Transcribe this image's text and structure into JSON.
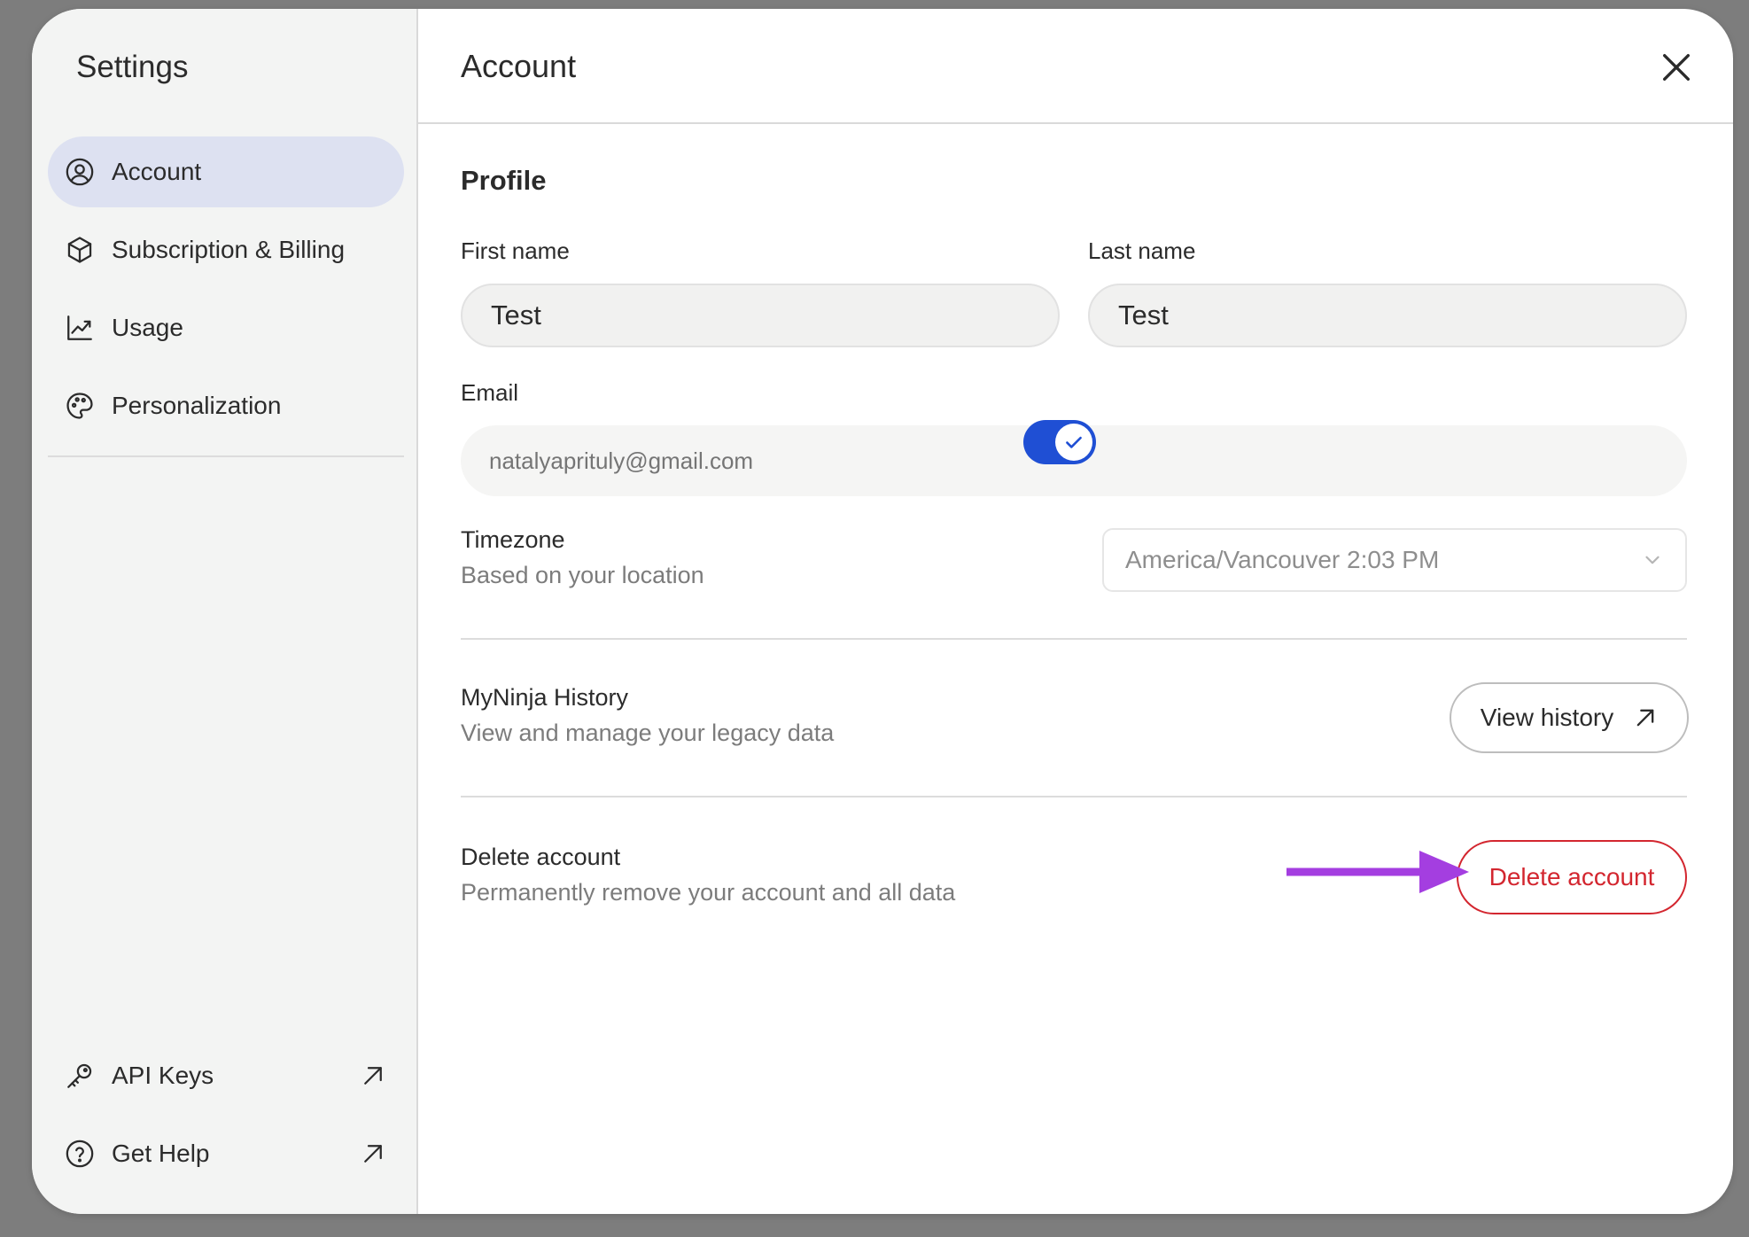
{
  "sidebar": {
    "title": "Settings",
    "items": [
      {
        "label": "Account",
        "icon": "user-circle-icon",
        "active": true
      },
      {
        "label": "Subscription & Billing",
        "icon": "cube-icon",
        "active": false
      },
      {
        "label": "Usage",
        "icon": "chart-line-icon",
        "active": false
      },
      {
        "label": "Personalization",
        "icon": "palette-icon",
        "active": false
      }
    ],
    "bottom_items": [
      {
        "label": "API Keys",
        "icon": "key-icon",
        "external": true
      },
      {
        "label": "Get Help",
        "icon": "help-circle-icon",
        "external": true
      }
    ]
  },
  "main": {
    "title": "Account",
    "profile": {
      "section_title": "Profile",
      "first_name_label": "First name",
      "first_name_value": "Test",
      "last_name_label": "Last name",
      "last_name_value": "Test",
      "email_label": "Email",
      "email_placeholder": "natalyaprituly@gmail.com"
    },
    "timezone": {
      "title": "Timezone",
      "subtitle": "Based on your location",
      "auto_enabled": true,
      "selected": "America/Vancouver 2:03 PM"
    },
    "history": {
      "title": "MyNinja History",
      "subtitle": "View and manage your legacy data",
      "button_label": "View history"
    },
    "delete": {
      "title": "Delete account",
      "subtitle": "Permanently remove your account and all data",
      "button_label": "Delete account"
    }
  },
  "colors": {
    "accent": "#1f4fd4",
    "active_nav": "#dde1f1",
    "danger": "#d3262f",
    "annotation_arrow": "#a43ee0"
  }
}
